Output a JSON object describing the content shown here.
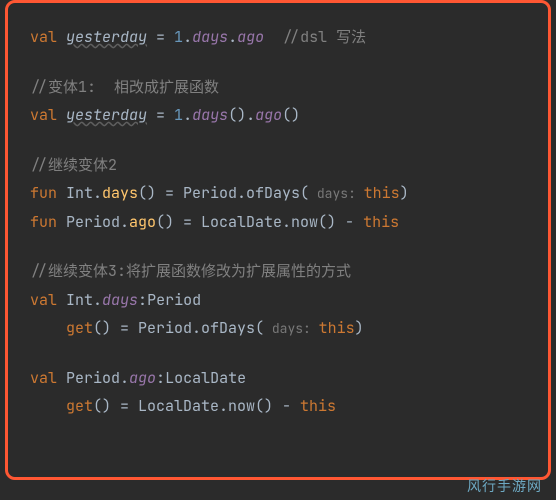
{
  "code": {
    "l1": {
      "kw": "val ",
      "var": "yesterday",
      "eq": " = ",
      "n": "1",
      "dot1": ".",
      "p1": "days",
      "dot2": ".",
      "p2": "ago",
      "sp": "  ",
      "cmt": "//dsl 写法"
    },
    "l3": {
      "cmt": "//变体1:  相改成扩展函数"
    },
    "l4": {
      "kw": "val ",
      "var": "yesterday",
      "eq": " = ",
      "n": "1",
      "dot1": ".",
      "m1": "days",
      "paren1": "().",
      "m2": "ago",
      "paren2": "()"
    },
    "l6": {
      "cmt": "//继续变体2"
    },
    "l7": {
      "kw": "fun ",
      "recv": "Int.",
      "name": "days",
      "sig": "() = Period.ofDays(",
      "hint": " days: ",
      "arg": "this",
      "close": ")"
    },
    "l8": {
      "kw": "fun ",
      "recv": "Period.",
      "name": "ago",
      "sig": "() = LocalDate.now() - ",
      "arg": "this"
    },
    "l10": {
      "cmt": "//继续变体3:将扩展函数修改为扩展属性的方式"
    },
    "l11": {
      "kw": "val ",
      "recv": "Int.",
      "name": "days",
      "colon": ":",
      "type": "Period"
    },
    "l12": {
      "indent": "    ",
      "get": "get",
      "sig": "() = Period.ofDays(",
      "hint": " days: ",
      "arg": "this",
      "close": ")"
    },
    "l14": {
      "kw": "val ",
      "recv": "Period.",
      "name": "ago",
      "colon": ":",
      "type": "LocalDate"
    },
    "l15": {
      "indent": "    ",
      "get": "get",
      "sig": "() = LocalDate.now() - ",
      "arg": "this"
    }
  },
  "watermark": "风行手游网"
}
